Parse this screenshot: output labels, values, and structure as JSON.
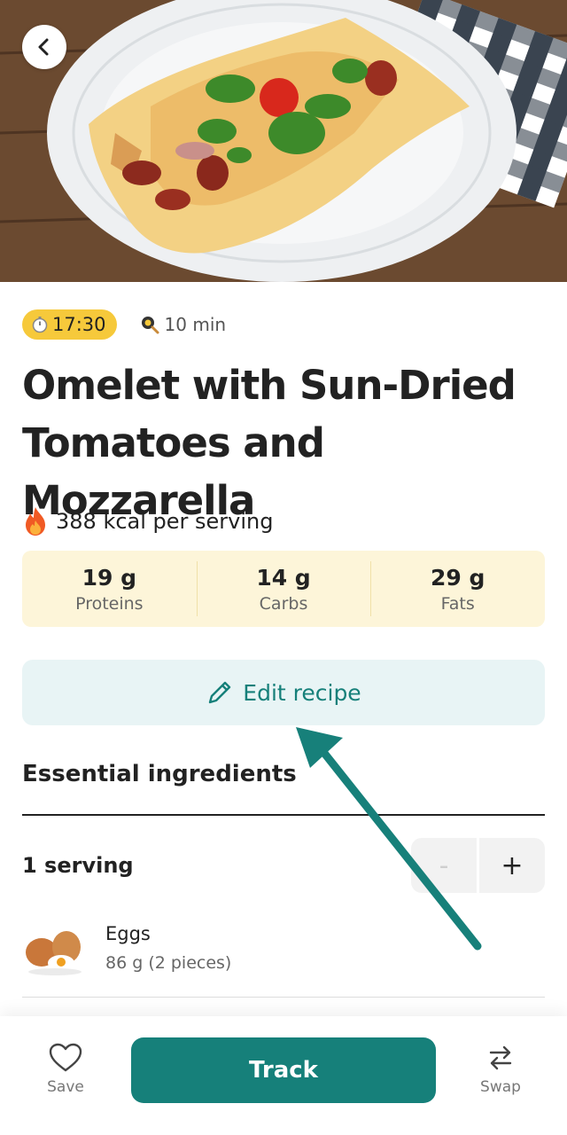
{
  "header": {
    "back_icon": "chevron-left-icon"
  },
  "meta": {
    "time": "17:30",
    "time_icon": "stopwatch-icon",
    "duration": "10 min",
    "duration_icon": "frying-pan-icon"
  },
  "recipe": {
    "title_line1": "Omelet with Sun-Dried",
    "title_line2": "Tomatoes and Mozzarella",
    "kcal": "388 kcal per serving",
    "kcal_icon": "fire-icon"
  },
  "macros": [
    {
      "value": "19 g",
      "label": "Proteins"
    },
    {
      "value": "14 g",
      "label": "Carbs"
    },
    {
      "value": "29 g",
      "label": "Fats"
    }
  ],
  "edit": {
    "label": "Edit recipe",
    "icon": "pencil-icon"
  },
  "ingredients_section": {
    "title": "Essential ingredients",
    "serving": "1 serving",
    "minus": "-",
    "plus": "+",
    "items": [
      {
        "name": "Eggs",
        "qty": "86 g (2 pieces)"
      }
    ]
  },
  "bottom_bar": {
    "save_label": "Save",
    "track_label": "Track",
    "swap_label": "Swap"
  },
  "colors": {
    "accent": "#16807a",
    "badge": "#f6c93b",
    "macro_bg": "#fdf5d9",
    "edit_bg": "#e8f4f5",
    "annotation_arrow": "#17807a"
  }
}
